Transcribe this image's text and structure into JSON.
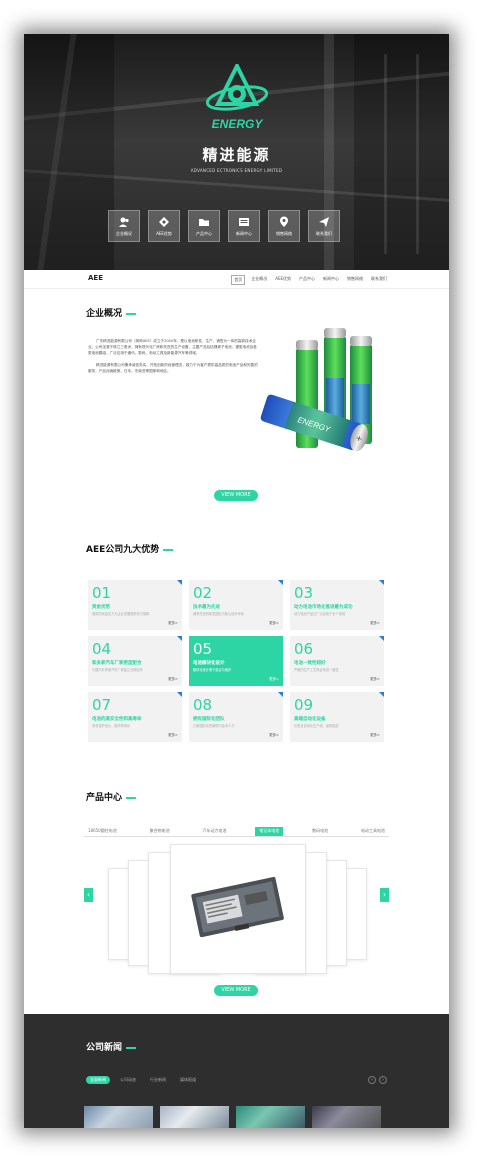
{
  "hero": {
    "logo_text": "ENERGY",
    "title": "精进能源",
    "subtitle": "ADVANCED ECTRONICS ENERGY LIMITED",
    "icons": [
      {
        "label": "企业概况",
        "icon": "users-icon"
      },
      {
        "label": "AEE优势",
        "icon": "diamond-icon"
      },
      {
        "label": "产品中心",
        "icon": "folder-icon"
      },
      {
        "label": "新闻中心",
        "icon": "news-icon"
      },
      {
        "label": "销售网络",
        "icon": "location-icon"
      },
      {
        "label": "联系我们",
        "icon": "send-icon"
      }
    ]
  },
  "nav": {
    "brand": "AEE",
    "links": [
      "首页",
      "企业概况",
      "AEE优势",
      "产品中心",
      "新闻中心",
      "销售网络",
      "联系我们"
    ],
    "active": 0
  },
  "about": {
    "title": "企业概况",
    "paragraphs": [
      "广东精进能源有限公司（简称AEE）成立于2000年，是以电池研发、生产、销售为一体的高新技术企业。公司坐落于珠江三角洲，拥有现代化厂房和先进的生产设备，主要产品包括锂离子电池、镍氢电池及各类电池模组，广泛应用于通讯、数码、电动工具及新能源汽车等领域。",
      "精进能源有限公司秉承诚信务实、开拓创新的经营理念，致力于为客户提供高品质的电池产品和完善的服务，产品远销欧美、日本、东南亚等国家和地区。"
    ],
    "button": "VIEW MORE"
  },
  "advantages": {
    "title": "AEE公司九大优势",
    "more_label": "更多>",
    "items": [
      {
        "num": "01",
        "title": "资金优势",
        "desc": "雄厚的资金实力为企业发展提供有力保障"
      },
      {
        "num": "02",
        "title": "技术最为先进",
        "desc": "拥有先进的研发团队与核心技术专利"
      },
      {
        "num": "03",
        "title": "动力电池市场化推进最为成功",
        "desc": "动力电池产品已广泛应用于多个领域"
      },
      {
        "num": "04",
        "title": "和多家汽车厂家密度配合",
        "desc": "与国内外多家汽车厂家建立长期合作"
      },
      {
        "num": "05",
        "title": "电池模块化设计",
        "desc": "模块化设计便于组合与维护"
      },
      {
        "num": "06",
        "title": "电池一致性超好",
        "desc": "严格的生产工艺保证电池一致性"
      },
      {
        "num": "07",
        "title": "电池的高安全性和高寿命",
        "desc": "多重保护设计，循环寿命长"
      },
      {
        "num": "08",
        "title": "拥有国际化团队",
        "desc": "汇聚国际化的管理与技术人才"
      },
      {
        "num": "09",
        "title": "高端自动化设备",
        "desc": "引进全自动化生产线，品质稳定"
      }
    ],
    "active_index": 4
  },
  "products": {
    "title": "产品中心",
    "tabs": [
      "18650圆柱电池",
      "聚合物电池",
      "汽车动力电池",
      "笔记本电池",
      "数码电池",
      "电动工具电池"
    ],
    "active_tab": 3,
    "button": "VIEW MORE"
  },
  "news": {
    "title": "公司新闻",
    "tabs": [
      "全部新闻",
      "公司动态",
      "行业新闻",
      "媒体报道"
    ],
    "active_tab": 0
  },
  "colors": {
    "accent": "#2dd4a4",
    "dark": "#2e2e2e"
  }
}
